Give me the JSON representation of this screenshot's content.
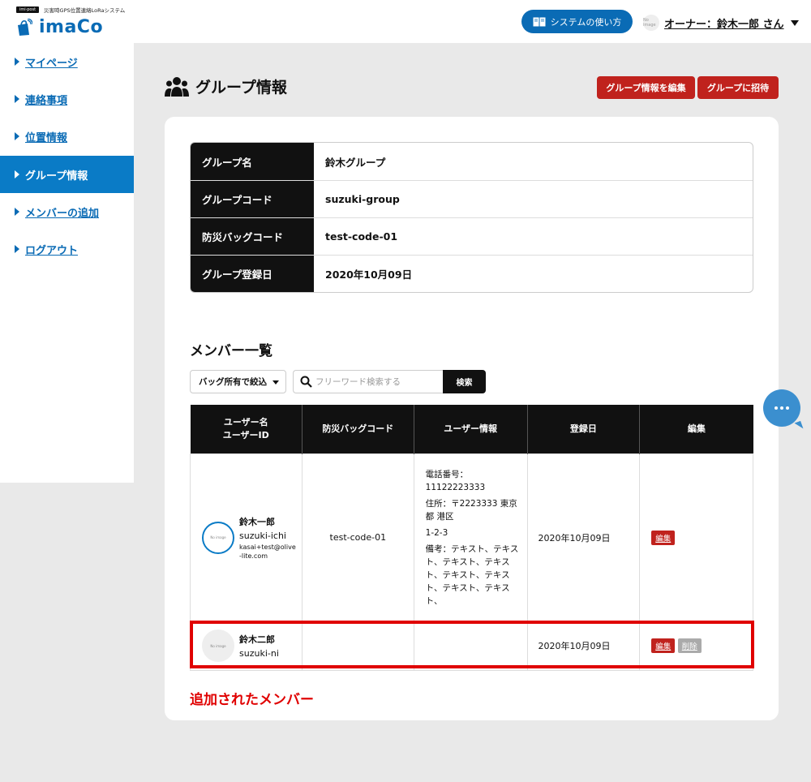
{
  "header": {
    "mini_logo": "imi·post",
    "tagline": "災害時GPS位置連絡LoRaシステム",
    "app_name": "imaCo",
    "howto_label": "システムの使い方",
    "avatar_text": "No image",
    "user_label": "オーナー：鈴木一郎 さん"
  },
  "sidebar": {
    "items": [
      {
        "label": "マイページ"
      },
      {
        "label": "連絡事項"
      },
      {
        "label": "位置情報"
      },
      {
        "label": "グループ情報"
      },
      {
        "label": "メンバーの追加"
      },
      {
        "label": "ログアウト"
      }
    ],
    "active": "グループ情報"
  },
  "page": {
    "title": "グループ情報",
    "edit_group_label": "グループ情報を編集",
    "invite_label": "グループに招待"
  },
  "group_info": {
    "rows": [
      {
        "key": "グループ名",
        "value": "鈴木グループ"
      },
      {
        "key": "グループコード",
        "value": "suzuki-group"
      },
      {
        "key": "防災バッグコード",
        "value": "test-code-01"
      },
      {
        "key": "グループ登録日",
        "value": "2020年10月09日"
      }
    ]
  },
  "members": {
    "title": "メンバー一覧",
    "filter_label": "バッグ所有で絞込",
    "search_placeholder": "フリーワード検索する",
    "search_button": "検索",
    "columns": [
      "ユーザー名",
      "ユーザーID",
      "防災バッグコード",
      "ユーザー情報",
      "登録日",
      "編集"
    ],
    "rows": [
      {
        "avatar": "No image",
        "name": "鈴木一郎",
        "user_id": "suzuki-ichi",
        "email": "kasai+test@olive-lite.com",
        "bag_code": "test-code-01",
        "phone_label": "電話番号：",
        "phone": "11122223333",
        "address_label": "住所：",
        "address": "〒2223333 東京都 港区",
        "address2": "1-2-3",
        "note_label": "備考：",
        "note": "テキスト、テキスト、テキスト、テキスト、テキスト、テキスト、テキスト、テキスト、",
        "date": "2020年10月09日",
        "edit": "編集"
      },
      {
        "avatar": "No image",
        "name": "鈴木二郎",
        "user_id": "suzuki-ni",
        "bag_code": "",
        "info": "",
        "date": "2020年10月09日",
        "edit": "編集",
        "delete": "削除"
      }
    ]
  },
  "annotation": {
    "label": "追加されたメンバー",
    "color": "#e00000"
  },
  "colors": {
    "brand": "#0a6bb5",
    "active_nav": "#0a7bc6",
    "red_button": "#c0221d"
  }
}
